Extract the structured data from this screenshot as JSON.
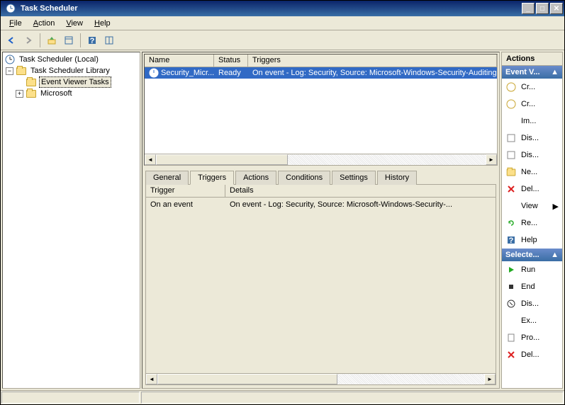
{
  "title": "Task Scheduler",
  "menus": {
    "file": "File",
    "action": "Action",
    "view": "View",
    "help": "Help"
  },
  "tree": {
    "root": "Task Scheduler (Local)",
    "library": "Task Scheduler Library",
    "eventViewer": "Event Viewer Tasks",
    "microsoft": "Microsoft"
  },
  "taskList": {
    "cols": {
      "name": "Name",
      "status": "Status",
      "triggers": "Triggers"
    },
    "row": {
      "name": "Security_Micr...",
      "status": "Ready",
      "triggers": "On event - Log: Security, Source: Microsoft-Windows-Security-Auditing"
    }
  },
  "tabs": {
    "general": "General",
    "triggers": "Triggers",
    "actions": "Actions",
    "conditions": "Conditions",
    "settings": "Settings",
    "history": "History"
  },
  "triggers": {
    "col1": "Trigger",
    "col2": "Details",
    "r1": "On an event",
    "r2": "On event - Log: Security, Source: Microsoft-Windows-Security-..."
  },
  "actions": {
    "title": "Actions",
    "head1": "Event V...",
    "items1": {
      "cr1": "Cr...",
      "cr2": "Cr...",
      "im": "Im...",
      "dis1": "Dis...",
      "dis2": "Dis...",
      "ne": "Ne...",
      "del": "Del...",
      "view": "View",
      "re": "Re...",
      "help": "Help"
    },
    "head2": "Selecte...",
    "items2": {
      "run": "Run",
      "end": "End",
      "dis": "Dis...",
      "ex": "Ex...",
      "pro": "Pro...",
      "del": "Del..."
    }
  }
}
